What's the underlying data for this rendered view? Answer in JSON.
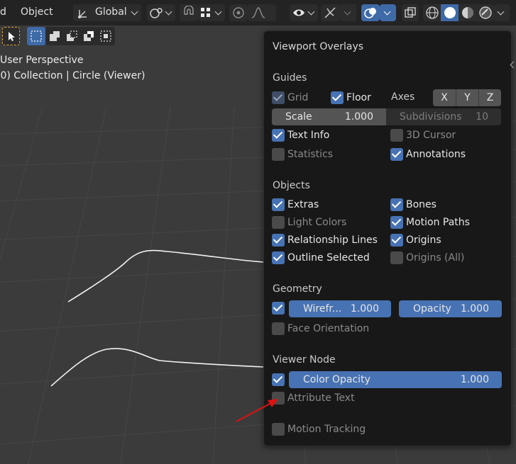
{
  "header": {
    "menu_fragment": "d",
    "menu_object": "Object",
    "transform_orientation": "Global"
  },
  "viewport": {
    "perspective": "User Perspective",
    "collection_info": "(0) Collection | Circle (Viewer)"
  },
  "overlays": {
    "title": "Viewport Overlays",
    "guides": {
      "heading": "Guides",
      "grid": "Grid",
      "floor": "Floor",
      "axes_label": "Axes",
      "axis_x": "X",
      "axis_y": "Y",
      "axis_z": "Z",
      "scale_label": "Scale",
      "scale_value": "1.000",
      "subdivisions_label": "Subdivisions",
      "subdivisions_value": "10",
      "text_info": "Text Info",
      "cursor_3d": "3D Cursor",
      "statistics": "Statistics",
      "annotations": "Annotations"
    },
    "objects": {
      "heading": "Objects",
      "extras": "Extras",
      "bones": "Bones",
      "light_colors": "Light Colors",
      "motion_paths": "Motion Paths",
      "relationship_lines": "Relationship Lines",
      "origins": "Origins",
      "outline_selected": "Outline Selected",
      "origins_all": "Origins (All)"
    },
    "geometry": {
      "heading": "Geometry",
      "wireframe_label": "Wirefr...",
      "wireframe_value": "1.000",
      "opacity_label": "Opacity",
      "opacity_value": "1.000",
      "face_orientation": "Face Orientation"
    },
    "viewer_node": {
      "heading": "Viewer Node",
      "color_opacity_label": "Color Opacity",
      "color_opacity_value": "1.000",
      "attribute_text": "Attribute Text"
    },
    "motion_tracking": "Motion Tracking"
  },
  "colors": {
    "accent": "#4772b3",
    "panel_bg": "#181818",
    "annotation_arrow": "#e01010"
  }
}
